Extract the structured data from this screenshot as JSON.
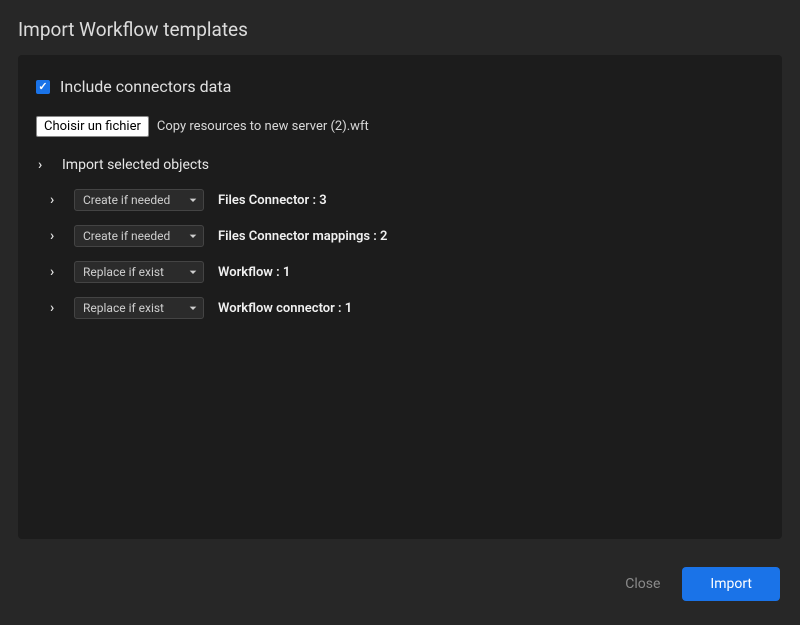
{
  "header": {
    "title": "Import Workflow templates"
  },
  "checkbox": {
    "label": "Include connectors data",
    "checked": true
  },
  "file": {
    "button_label": "Choisir un fichier",
    "filename": "Copy resources to new server (2).wft"
  },
  "section": {
    "label": "Import selected objects"
  },
  "action_options": {
    "create_if_needed": "Create if needed",
    "replace_if_exist": "Replace if exist"
  },
  "objects": [
    {
      "action": "Create if needed",
      "label": "Files Connector : 3"
    },
    {
      "action": "Create if needed",
      "label": "Files Connector mappings : 2"
    },
    {
      "action": "Replace if exist",
      "label": "Workflow : 1"
    },
    {
      "action": "Replace if exist",
      "label": "Workflow connector : 1"
    }
  ],
  "footer": {
    "close_label": "Close",
    "import_label": "Import"
  }
}
